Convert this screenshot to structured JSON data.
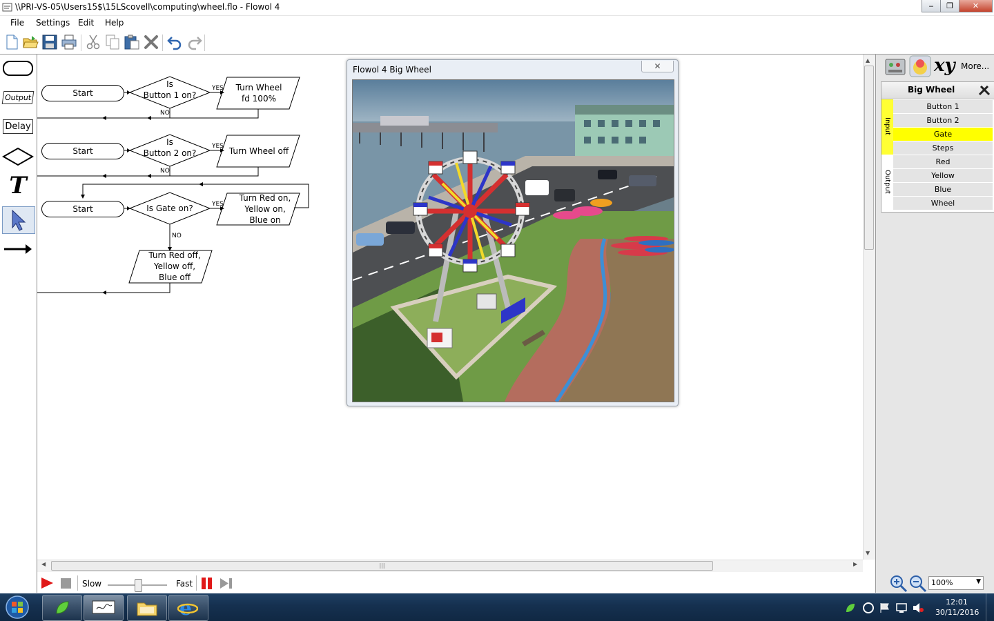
{
  "window": {
    "title": "\\\\PRI-VS-05\\Users15$\\15LScovell\\computing\\wheel.flo - Flowol 4",
    "minimize": "‒",
    "maximize": "❐",
    "close": "✕"
  },
  "menu": [
    "File",
    "Settings",
    "Edit",
    "Help"
  ],
  "toolbar": [
    "new-icon",
    "open-icon",
    "save-icon",
    "print-icon",
    "cut-icon",
    "copy-icon",
    "paste-icon",
    "delete-icon",
    "undo-icon",
    "redo-icon"
  ],
  "palette": {
    "output": "Output",
    "delay": "Delay",
    "text": "T"
  },
  "flowchart": {
    "row1": {
      "start": "Start",
      "decision_1": "Is",
      "decision_2": "Button 1 on?",
      "yes": "YES",
      "no": "NO",
      "output_1": "Turn Wheel",
      "output_2": "fd 100%"
    },
    "row2": {
      "start": "Start",
      "decision_1": "Is",
      "decision_2": "Button 2 on?",
      "yes": "YES",
      "no": "NO",
      "output_1": "Turn Wheel off"
    },
    "row3": {
      "start": "Start",
      "decision_1": "Is Gate on?",
      "yes": "YES",
      "no": "NO",
      "output_1": "Turn Red on,",
      "output_2": "Yellow on,",
      "output_3": "Blue on",
      "off_1": "Turn Red off,",
      "off_2": "Yellow off,",
      "off_3": "Blue off"
    }
  },
  "mimic_window": {
    "title": "Flowol 4 Big Wheel",
    "close": "✕"
  },
  "right_panel": {
    "more": "More...",
    "xy": "xy",
    "title": "Big Wheel",
    "input_label": "Input",
    "output_label": "Output",
    "inputs": [
      "Button 1",
      "Button 2",
      "Gate",
      "Steps"
    ],
    "outputs": [
      "Red",
      "Yellow",
      "Blue",
      "Wheel"
    ],
    "active_input": "Gate",
    "highlight_color": "#ffff00"
  },
  "controls": {
    "slow": "Slow",
    "fast": "Fast",
    "zoom": "100%"
  },
  "taskbar": {
    "time": "12:01",
    "date": "30/11/2016"
  },
  "scroll": {
    "grip": "|||"
  }
}
